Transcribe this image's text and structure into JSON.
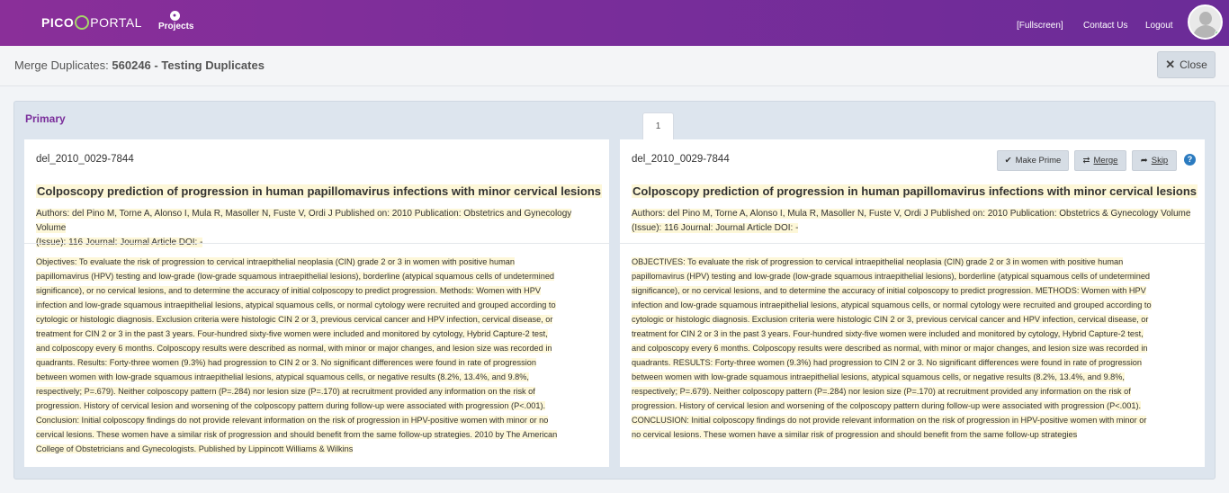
{
  "nav": {
    "logo_part1": "PICO",
    "logo_part2": "PORTAL",
    "projects_label": "Projects",
    "fullscreen_label": "[Fullscreen]",
    "contact_label": "Contact Us",
    "logout_label": "Logout"
  },
  "page": {
    "title_prefix": "Merge Duplicates:",
    "title_name": "560246 - Testing Duplicates",
    "close_label": "Close"
  },
  "panel": {
    "primary_label": "Primary",
    "tab_label": "1"
  },
  "left": {
    "id": "del_2010_0029-7844",
    "title": "Colposcopy prediction of progression in human papillomavirus infections with minor cervical lesions",
    "meta_line1": "Authors: del Pino M, Torne A, Alonso I, Mula R, Masoller N, Fuste V, Ordi J Published on: 2010 Publication: Obstetrics and Gynecology Volume",
    "meta_line2": "(Issue): 116 Journal: Journal Article DOI: -",
    "abstract": [
      "Objectives: To evaluate the risk of progression to cervical intraepithelial neoplasia (CIN) grade 2 or 3 in women with positive human",
      "papillomavirus (HPV) testing and low-grade (low-grade squamous intraepithelial lesions), borderline (atypical squamous cells of undetermined",
      "significance), or no cervical lesions, and to determine the accuracy of initial colposcopy to predict progression. Methods: Women with HPV",
      "infection and low-grade squamous intraepithelial lesions, atypical squamous cells, or normal cytology were recruited and grouped according to",
      "cytologic or histologic diagnosis. Exclusion criteria were histologic CIN 2 or 3, previous cervical cancer and HPV infection, cervical disease, or",
      "treatment for CIN 2 or 3 in the past 3 years. Four-hundred sixty-five women were included and monitored by cytology, Hybrid Capture-2 test,",
      "and colposcopy every 6 months. Colposcopy results were described as normal, with minor or major changes, and lesion size was recorded in",
      "quadrants. Results: Forty-three women (9.3%) had progression to CIN 2 or 3. No significant differences were found in rate of progression",
      "between women with low-grade squamous intraepithelial lesions, atypical squamous cells, or negative results (8.2%, 13.4%, and 9.8%,",
      "respectively; P=.679). Neither colposcopy pattern (P=.284) nor lesion size (P=.170) at recruitment provided any information on the risk of",
      "progression. History of cervical lesion and worsening of the colposcopy pattern during follow-up were associated with progression (P<.001).",
      "Conclusion: Initial colposcopy findings do not provide relevant information on the risk of progression in HPV-positive women with minor or no",
      "cervical lesions. These women have a similar risk of progression and should benefit from the same follow-up strategies. 2010 by The American",
      "College of Obstetricians and Gynecologists. Published by Lippincott Williams & Wilkins"
    ]
  },
  "right": {
    "id": "del_2010_0029-7844",
    "make_prime_label": "Make Prime",
    "merge_label": "Merge",
    "skip_label": "Skip",
    "help_label": "?",
    "title": "Colposcopy prediction of progression in human papillomavirus infections with minor cervical lesions",
    "meta_line1": "Authors: del Pino M, Torne A, Alonso I, Mula R, Masoller N, Fuste V, Ordi J Published on: 2010 Publication: Obstetrics & Gynecology Volume",
    "meta_line2": "(Issue): 116 Journal: Journal Article DOI: -",
    "abstract": [
      "OBJECTIVES: To evaluate the risk of progression to cervical intraepithelial neoplasia (CIN) grade 2 or 3 in women with positive human",
      "papillomavirus (HPV) testing and low-grade (low-grade squamous intraepithelial lesions), borderline (atypical squamous cells of undetermined",
      "significance), or no cervical lesions, and to determine the accuracy of initial colposcopy to predict progression. METHODS: Women with HPV",
      "infection and low-grade squamous intraepithelial lesions, atypical squamous cells, or normal cytology were recruited and grouped according to",
      "cytologic or histologic diagnosis. Exclusion criteria were histologic CIN 2 or 3, previous cervical cancer and HPV infection, cervical disease, or",
      "treatment for CIN 2 or 3 in the past 3 years. Four-hundred sixty-five women were included and monitored by cytology, Hybrid Capture-2 test,",
      "and colposcopy every 6 months. Colposcopy results were described as normal, with minor or major changes, and lesion size was recorded in",
      "quadrants. RESULTS: Forty-three women (9.3%) had progression to CIN 2 or 3. No significant differences were found in rate of progression",
      "between women with low-grade squamous intraepithelial lesions, atypical squamous cells, or negative results (8.2%, 13.4%, and 9.8%,",
      "respectively; P=.679). Neither colposcopy pattern (P=.284) nor lesion size (P=.170) at recruitment provided any information on the risk of",
      "progression. History of cervical lesion and worsening of the colposcopy pattern during follow-up were associated with progression (P<.001).",
      "CONCLUSION: Initial colposcopy findings do not provide relevant information on the risk of progression in HPV-positive women with minor or",
      "no cervical lesions. These women have a similar risk of progression and should benefit from the same follow-up strategies"
    ]
  },
  "colors": {
    "brand_purple": "#7a2d9a",
    "highlight": "#fdf7d8",
    "help_blue": "#2b7bc0"
  }
}
